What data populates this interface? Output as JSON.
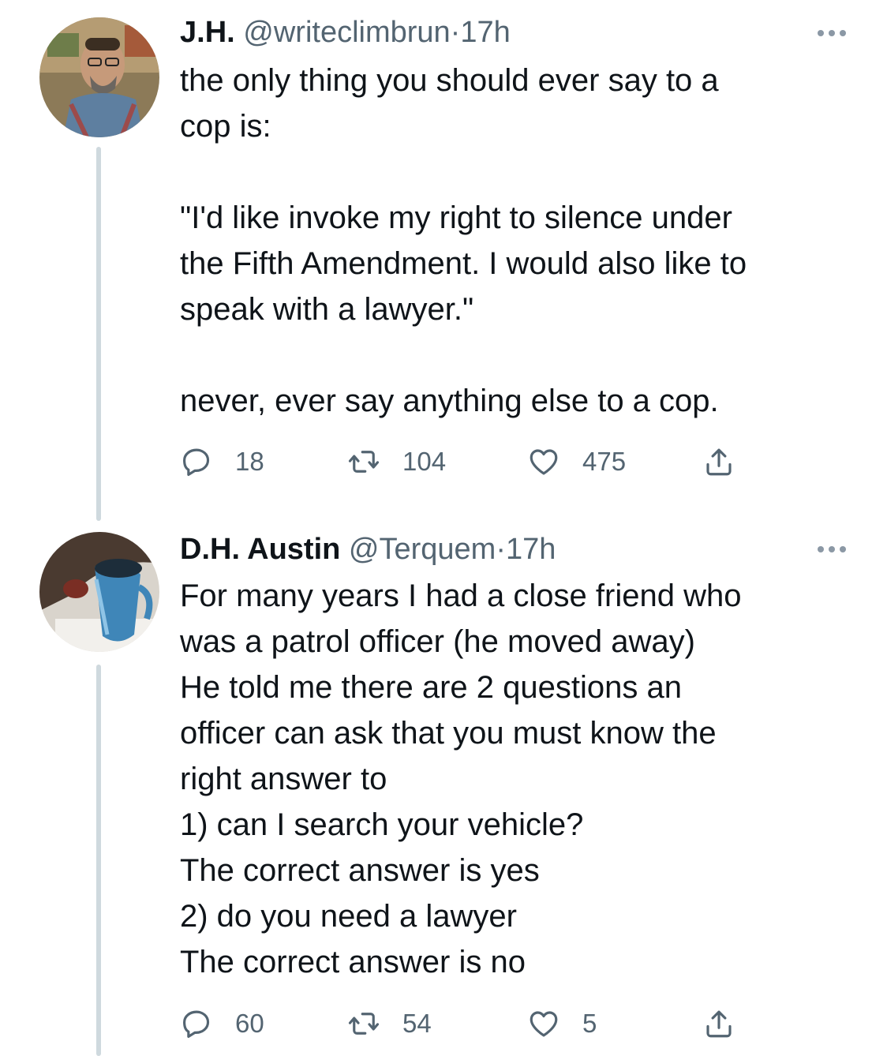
{
  "tweets": [
    {
      "name": "J.H.",
      "handle": "@writeclimbrun",
      "separator": "·",
      "time": "17h",
      "lines": [
        "the only thing you should ever say to a",
        "cop is:",
        "",
        "\"I'd like invoke my right to silence under",
        "the Fifth Amendment. I would also like to",
        "speak with a lawyer.\"",
        "",
        "never, ever say anything else to a cop."
      ],
      "replies": "18",
      "retweets": "104",
      "likes": "475",
      "icons": {
        "reply": "reply-icon",
        "retweet": "retweet-icon",
        "like": "heart-icon",
        "share": "share-icon",
        "more": "more-icon"
      }
    },
    {
      "name": "D.H. Austin",
      "handle": "@Terquem",
      "separator": "·",
      "time": "17h",
      "lines": [
        "For many years I had a close friend who",
        "was a patrol officer (he moved away)",
        "He told me there are 2 questions an",
        "officer can ask that you must know the",
        "right answer to",
        "1) can I search your vehicle?",
        "The correct answer is yes",
        "2) do you need a lawyer",
        "The correct answer is no"
      ],
      "replies": "60",
      "retweets": "54",
      "likes": "5",
      "icons": {
        "reply": "reply-icon",
        "retweet": "retweet-icon",
        "like": "heart-icon",
        "share": "share-icon",
        "more": "more-icon"
      }
    }
  ],
  "colors": {
    "text": "#0f1419",
    "secondary": "#536471",
    "thread_line": "#cfd9de"
  }
}
